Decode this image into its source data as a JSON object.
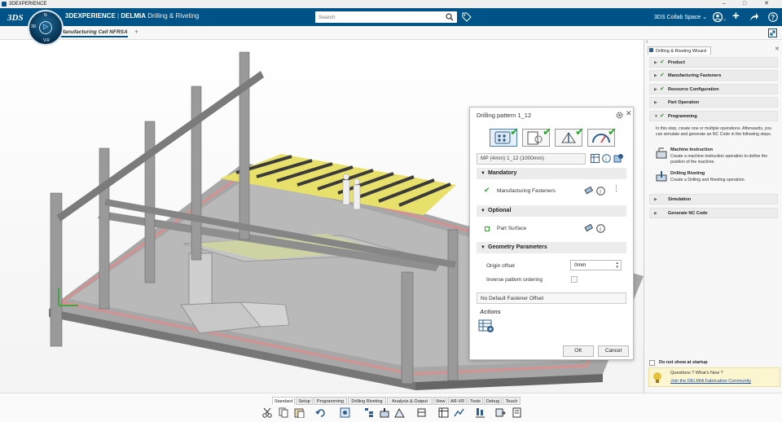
{
  "window": {
    "title": "3DEXPERIENCE",
    "minimize": "–",
    "maximize": "□",
    "close": "✕"
  },
  "header": {
    "brand": "3DEXPERIENCE",
    "separator": "|",
    "brand_app": "DELMIA",
    "app_name": "Drilling & Riveting",
    "search_placeholder": "Search",
    "collab_space": "3DS Collab Space",
    "compass_labels": {
      "top": "N",
      "left": "3D",
      "right": "V.R",
      "bottom": ""
    }
  },
  "tabs": {
    "active": "Manufacturing Cell NFRSA",
    "add": "+"
  },
  "dialog": {
    "title": "Drilling pattern 1_12",
    "name_field": "MP (4mm) 1_12 (1000mm)",
    "sections": {
      "mandatory": "Mandatory",
      "optional": "Optional",
      "geometry": "Geometry Parameters"
    },
    "mandatory_item": "Manufacturing Fasteners",
    "optional_item": "Part Surface",
    "origin_offset_label": "Origin offset",
    "origin_offset_value": "0mm",
    "inverse_label": "Inverse pattern ordering",
    "fastener_offset": "No Default Fastener Offset",
    "actions_label": "Actions",
    "ok": "OK",
    "cancel": "Cancel"
  },
  "wizard": {
    "title": "Drilling & Riveting Wizard",
    "items": [
      {
        "label": "Product",
        "done": true,
        "expanded": false
      },
      {
        "label": "Manufacturing Fasteners",
        "done": true,
        "expanded": false
      },
      {
        "label": "Resource Configuration",
        "done": true,
        "expanded": false
      },
      {
        "label": "Part Operation",
        "done": false,
        "expanded": false
      },
      {
        "label": "Programming",
        "done": true,
        "expanded": true
      },
      {
        "label": "Simulation",
        "done": false,
        "expanded": false
      },
      {
        "label": "Generate NC Code",
        "done": false,
        "expanded": false
      }
    ],
    "programming_desc": "In this step, create one or multiple operations. Afterwards, you can simulate and generate an NC Code in the following steps.",
    "step1_title": "Machine Instruction",
    "step1_desc": "Create a machine instruction operation to define the position of the machine.",
    "step2_title": "Drilling Riveting",
    "step2_desc": "Create a Drilling and Riveting operation.",
    "startup_label": "Do not show at startup",
    "questions": "Questions ? What's New ?",
    "community_link": "Join the DELMIA Fabrication Community"
  },
  "bottom_tabs": [
    "Standard",
    "Setup",
    "Programming",
    "Drilling Riveting",
    "Analysis & Output",
    "View",
    "AR-VR",
    "Tools",
    "Debug",
    "Touch"
  ],
  "bottom_active": "Standard",
  "colors": {
    "brand": "#005386",
    "check": "#27a127",
    "link": "#1a4fb5"
  }
}
